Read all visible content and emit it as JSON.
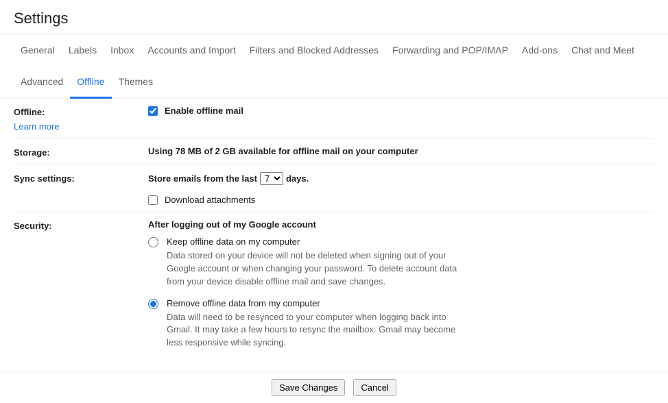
{
  "title": "Settings",
  "tabs": [
    {
      "label": "General"
    },
    {
      "label": "Labels"
    },
    {
      "label": "Inbox"
    },
    {
      "label": "Accounts and Import"
    },
    {
      "label": "Filters and Blocked Addresses"
    },
    {
      "label": "Forwarding and POP/IMAP"
    },
    {
      "label": "Add-ons"
    },
    {
      "label": "Chat and Meet"
    },
    {
      "label": "Advanced"
    },
    {
      "label": "Offline",
      "active": true
    },
    {
      "label": "Themes"
    }
  ],
  "offline": {
    "label": "Offline:",
    "learn_more": "Learn more",
    "enable_label": "Enable offline mail",
    "enable_checked": true
  },
  "storage": {
    "label": "Storage:",
    "text": "Using 78 MB of 2 GB available for offline mail on your computer"
  },
  "sync": {
    "label": "Sync settings:",
    "prefix": "Store emails from the last",
    "suffix": "days.",
    "selected": "7",
    "download_label": "Download attachments",
    "download_checked": false
  },
  "security": {
    "label": "Security:",
    "heading": "After logging out of my Google account",
    "options": [
      {
        "title": "Keep offline data on my computer",
        "desc": "Data stored on your device will not be deleted when signing out of your Google account or when changing your password. To delete account data from your device disable offline mail and save changes.",
        "checked": false
      },
      {
        "title": "Remove offline data from my computer",
        "desc": "Data will need to be resynced to your computer when logging back into Gmail. It may take a few hours to resync the mailbox. Gmail may become less responsive while syncing.",
        "checked": true
      }
    ]
  },
  "footer": {
    "save": "Save Changes",
    "cancel": "Cancel"
  }
}
